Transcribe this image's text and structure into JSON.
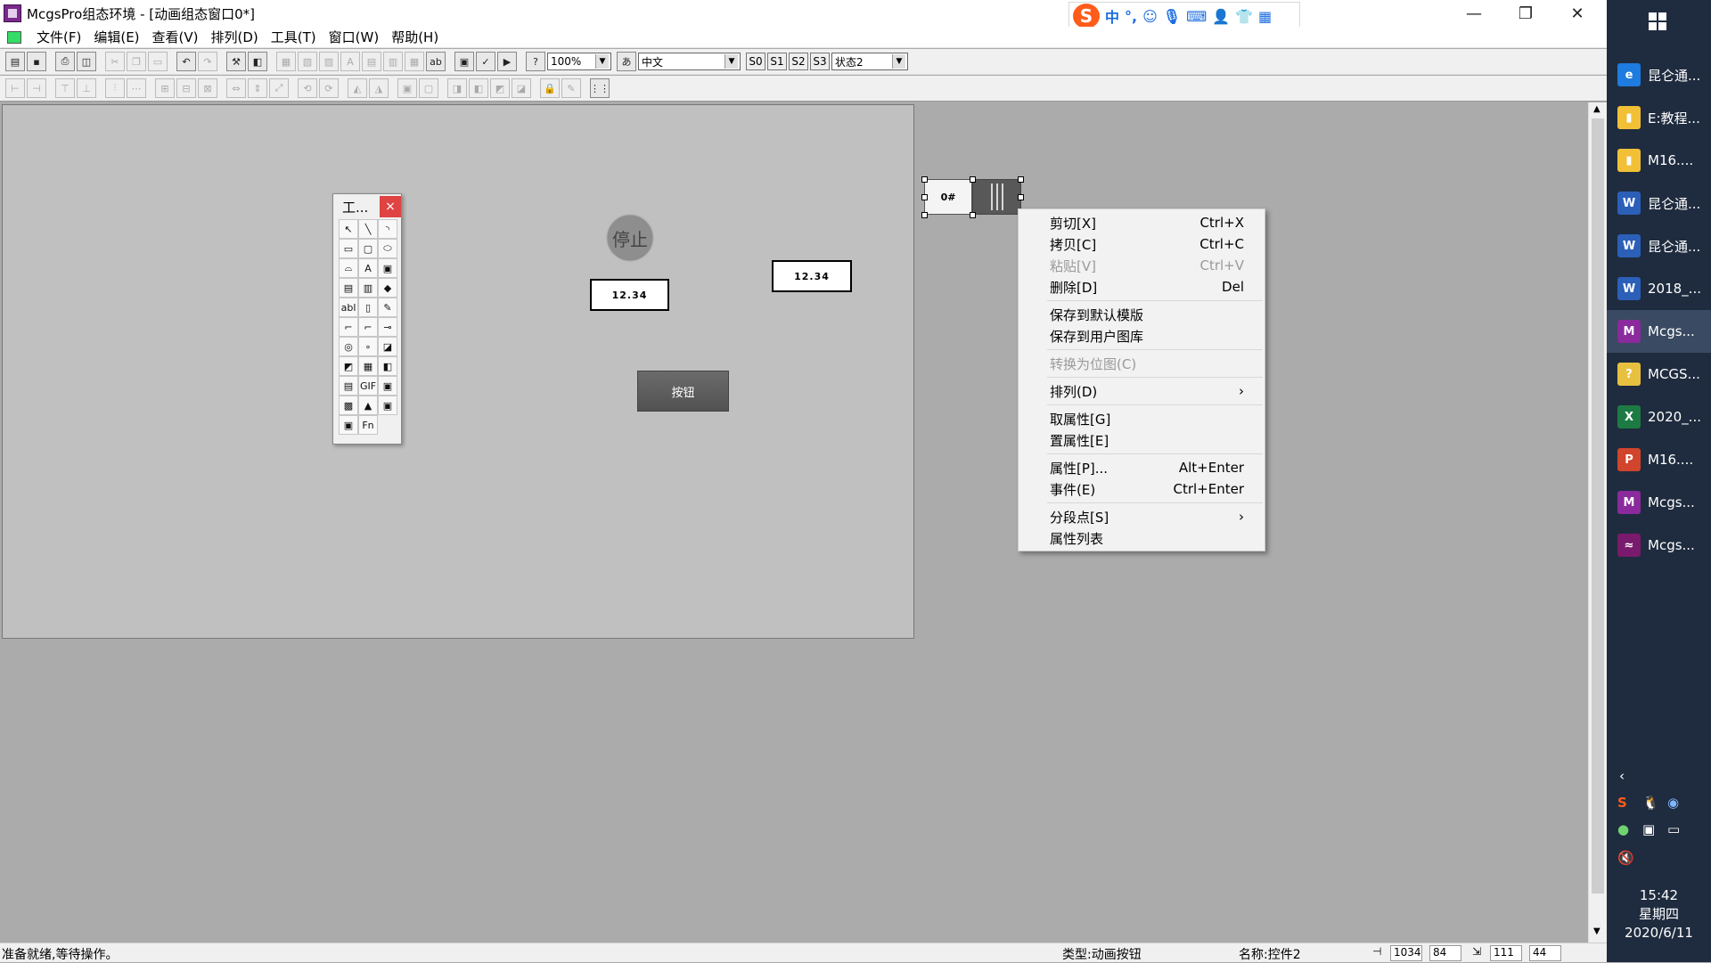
{
  "window": {
    "title": "McgsPro组态环境 - [动画组态窗口0*]"
  },
  "ime": {
    "logo": "S",
    "items": [
      "中",
      "°,",
      "☺",
      "🎙",
      "⌨",
      "👤",
      "👕",
      "▦"
    ]
  },
  "menu": [
    "文件(F)",
    "编辑(E)",
    "查看(V)",
    "排列(D)",
    "工具(T)",
    "窗口(W)",
    "帮助(H)"
  ],
  "toolbar": {
    "zoom": "100%",
    "language": "中文",
    "state_buttons": [
      "S0",
      "S1",
      "S2",
      "S3"
    ],
    "state": "状态2"
  },
  "toolbox": {
    "title": "工...",
    "close": "×",
    "tools": [
      "↖",
      "╲",
      "◝",
      "▭",
      "▢",
      "⬭",
      "⌓",
      "A",
      "▣",
      "▤",
      "▥",
      "◆",
      "abl",
      "▯",
      "✎",
      "⌐",
      "⌐",
      "⊸",
      "◎",
      "∘",
      "◪",
      "◩",
      "▦",
      "◧",
      "▤",
      "GIF",
      "▣",
      "▩",
      "▲",
      "▣",
      "▣",
      "Fn"
    ]
  },
  "canvas": {
    "stop_label": "停止",
    "num1": "12.34",
    "num2": "12.34",
    "button_label": "按钮",
    "selected_left": "0#"
  },
  "context_menu": [
    {
      "label": "剪切[X]",
      "shortcut": "Ctrl+X",
      "disabled": false
    },
    {
      "label": "拷贝[C]",
      "shortcut": "Ctrl+C",
      "disabled": false
    },
    {
      "label": "粘贴[V]",
      "shortcut": "Ctrl+V",
      "disabled": true
    },
    {
      "label": "删除[D]",
      "shortcut": "Del",
      "disabled": false
    },
    {
      "sep": true
    },
    {
      "label": "保存到默认模版",
      "shortcut": "",
      "disabled": false
    },
    {
      "label": "保存到用户图库",
      "shortcut": "",
      "disabled": false
    },
    {
      "sep": true
    },
    {
      "label": "转换为位图(C)",
      "shortcut": "",
      "disabled": true
    },
    {
      "sep": true
    },
    {
      "label": "排列(D)",
      "shortcut": "›",
      "disabled": false
    },
    {
      "sep": true
    },
    {
      "label": "取属性[G]",
      "shortcut": "",
      "disabled": false
    },
    {
      "label": "置属性[E]",
      "shortcut": "",
      "disabled": false
    },
    {
      "sep": true
    },
    {
      "label": "属性[P]...",
      "shortcut": "Alt+Enter",
      "disabled": false
    },
    {
      "label": "事件(E)",
      "shortcut": "Ctrl+Enter",
      "disabled": false
    },
    {
      "sep": true
    },
    {
      "label": "分段点[S]",
      "shortcut": "›",
      "disabled": false
    },
    {
      "label": "属性列表",
      "shortcut": "",
      "disabled": false
    }
  ],
  "status": {
    "message": "准备就绪,等待操作。",
    "type": "类型:动画按钮",
    "name": "名称:控件2",
    "x": "1034",
    "y": "84",
    "w": "111",
    "h": "44"
  },
  "taskbar": {
    "items": [
      {
        "label": "昆仑通...",
        "icon": "e",
        "color": "#1e7be0"
      },
      {
        "label": "E:教程...",
        "icon": "▮",
        "color": "#f2c037"
      },
      {
        "label": "M16....",
        "icon": "▮",
        "color": "#f2c037"
      },
      {
        "label": "昆仑通...",
        "icon": "W",
        "color": "#2b5fb8"
      },
      {
        "label": "昆仑通...",
        "icon": "W",
        "color": "#2b5fb8"
      },
      {
        "label": "2018_...",
        "icon": "W",
        "color": "#2b5fb8"
      },
      {
        "label": "Mcgs...",
        "icon": "M",
        "color": "#8a2a9c",
        "active": true
      },
      {
        "label": "MCGS...",
        "icon": "?",
        "color": "#e8c040"
      },
      {
        "label": "2020_...",
        "icon": "X",
        "color": "#1e7a43"
      },
      {
        "label": "M16....",
        "icon": "P",
        "color": "#d0452b"
      },
      {
        "label": "Mcgs...",
        "icon": "M",
        "color": "#8a2a9c"
      },
      {
        "label": "Mcgs...",
        "icon": "≈",
        "color": "#7a1a6c"
      }
    ],
    "time": "15:42",
    "weekday": "星期四",
    "date": "2020/6/11"
  }
}
